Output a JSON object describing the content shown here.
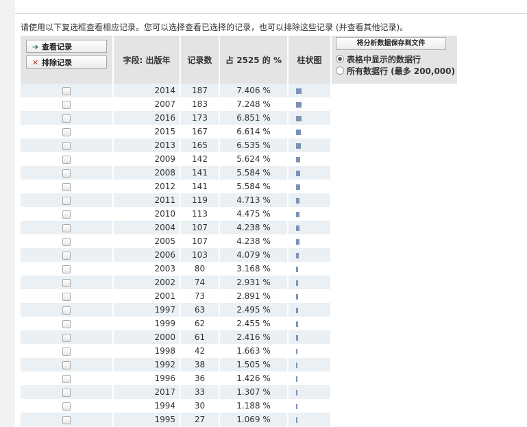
{
  "instruction": "请使用以下复选框查看相应记录。您可以选择查看已选择的记录，也可以排除这些记录 (并查看其他记录)。",
  "buttons": {
    "view": "查看记录",
    "exclude": "排除记录",
    "save": "将分析数据保存到文件"
  },
  "headers": {
    "field": "字段: 出版年",
    "count": "记录数",
    "percent": "占 2525 的 %",
    "bar": "柱状图"
  },
  "radio_options": {
    "shown": "表格中显示的数据行",
    "all": "所有数据行 (最多 200,000)"
  },
  "rows": [
    {
      "year": "2014",
      "count": "187",
      "percent": "7.406 %",
      "pct": 7.406
    },
    {
      "year": "2007",
      "count": "183",
      "percent": "7.248 %",
      "pct": 7.248
    },
    {
      "year": "2016",
      "count": "173",
      "percent": "6.851 %",
      "pct": 6.851
    },
    {
      "year": "2015",
      "count": "167",
      "percent": "6.614 %",
      "pct": 6.614
    },
    {
      "year": "2013",
      "count": "165",
      "percent": "6.535 %",
      "pct": 6.535
    },
    {
      "year": "2009",
      "count": "142",
      "percent": "5.624 %",
      "pct": 5.624
    },
    {
      "year": "2008",
      "count": "141",
      "percent": "5.584 %",
      "pct": 5.584
    },
    {
      "year": "2012",
      "count": "141",
      "percent": "5.584 %",
      "pct": 5.584
    },
    {
      "year": "2011",
      "count": "119",
      "percent": "4.713 %",
      "pct": 4.713
    },
    {
      "year": "2010",
      "count": "113",
      "percent": "4.475 %",
      "pct": 4.475
    },
    {
      "year": "2004",
      "count": "107",
      "percent": "4.238 %",
      "pct": 4.238
    },
    {
      "year": "2005",
      "count": "107",
      "percent": "4.238 %",
      "pct": 4.238
    },
    {
      "year": "2006",
      "count": "103",
      "percent": "4.079 %",
      "pct": 4.079
    },
    {
      "year": "2003",
      "count": "80",
      "percent": "3.168 %",
      "pct": 3.168
    },
    {
      "year": "2002",
      "count": "74",
      "percent": "2.931 %",
      "pct": 2.931
    },
    {
      "year": "2001",
      "count": "73",
      "percent": "2.891 %",
      "pct": 2.891
    },
    {
      "year": "1997",
      "count": "63",
      "percent": "2.495 %",
      "pct": 2.495
    },
    {
      "year": "1999",
      "count": "62",
      "percent": "2.455 %",
      "pct": 2.455
    },
    {
      "year": "2000",
      "count": "61",
      "percent": "2.416 %",
      "pct": 2.416
    },
    {
      "year": "1998",
      "count": "42",
      "percent": "1.663 %",
      "pct": 1.663
    },
    {
      "year": "1992",
      "count": "38",
      "percent": "1.505 %",
      "pct": 1.505
    },
    {
      "year": "1996",
      "count": "36",
      "percent": "1.426 %",
      "pct": 1.426
    },
    {
      "year": "2017",
      "count": "33",
      "percent": "1.307 %",
      "pct": 1.307
    },
    {
      "year": "1994",
      "count": "30",
      "percent": "1.188 %",
      "pct": 1.188
    },
    {
      "year": "1995",
      "count": "27",
      "percent": "1.069 %",
      "pct": 1.069
    }
  ],
  "colors": {
    "bar": "#7b93b4",
    "row_alt": "#eaf0f3",
    "header_bg": "#e4e4e4"
  }
}
